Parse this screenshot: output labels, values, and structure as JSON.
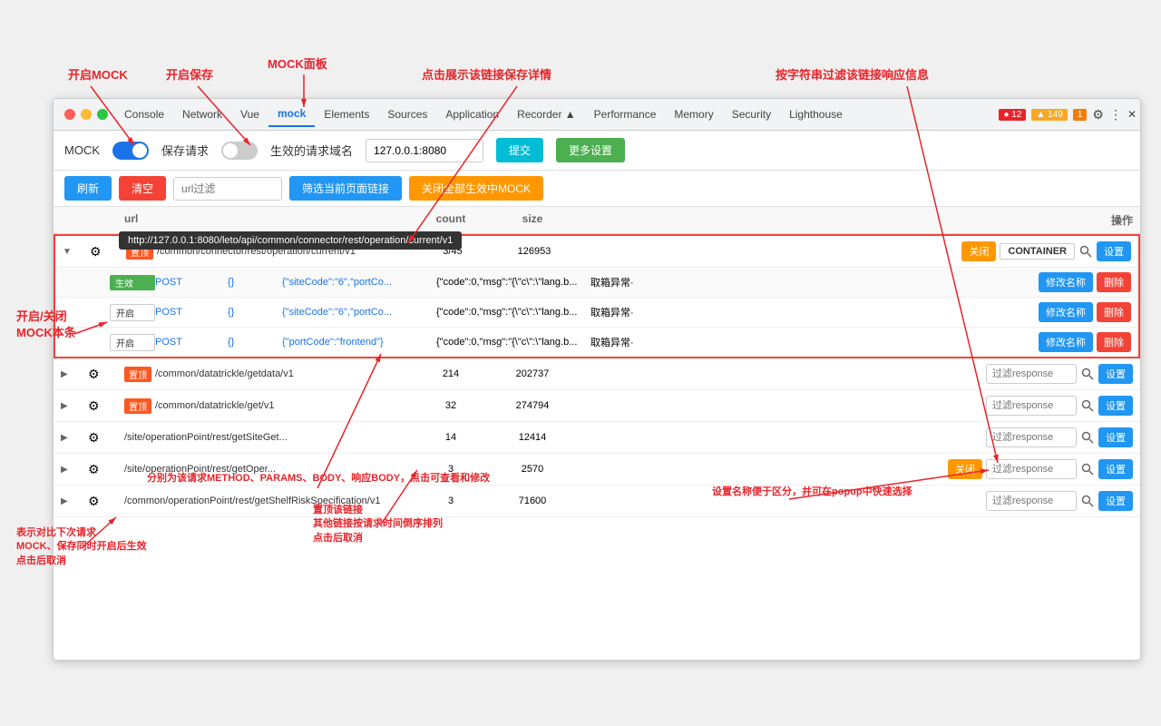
{
  "annotations": {
    "open_mock": "开启MOCK",
    "open_save": "开启保存",
    "mock_panel": "MOCK面板",
    "click_save_detail": "点击展示该链接保存详情",
    "filter_response": "按字符串过滤该链接响应信息",
    "toggle_mock_row": "开启/关闭\nMOCK本条",
    "next_request": "表示对比下次请求\nMOCK、保存同时开启后生效\n点击后取消",
    "set_top": "置顶该链接\n其他链接按请求时间倒序排列\n点击后取消"
  },
  "toolbar": {
    "mock_label": "MOCK",
    "save_label": "保存请求",
    "domain_label": "生效的请求域名",
    "domain_value": "127.0.0.1:8080",
    "submit_label": "提交",
    "more_settings_label": "更多设置"
  },
  "action_bar": {
    "refresh_label": "刷新",
    "clear_label": "清空",
    "url_filter_placeholder": "url过滤",
    "filter_page_label": "筛选当前页面链接",
    "close_all_label": "关闭全部生效中MOCK"
  },
  "table": {
    "headers": [
      "",
      "url",
      "count",
      "size",
      "操作"
    ],
    "url_tooltip": "http://127.0.0.1:8080/leto/api/common/connector/rest/operation/current/v1",
    "rows": [
      {
        "type": "main",
        "expanded": true,
        "tag": "置顶",
        "url": "/common/connector/rest/operation/current/v1",
        "count": "3/45",
        "size": "126953",
        "action_close": "关闭",
        "action_container": "CONTAINER",
        "action_set": "设置",
        "highlighted": true
      },
      {
        "type": "sub",
        "tag": "生效",
        "method": "POST",
        "params": "{}",
        "body": "{\"siteCode\":\"6\",\"portCo...",
        "response": "{\"code\":0,\"msg\":\"{\\\"c\\\":\\\"lang.b...",
        "label": "取箱异常·",
        "action_rename": "修改名称",
        "action_delete": "删除"
      },
      {
        "type": "sub",
        "tag": "开启",
        "method": "POST",
        "params": "{}",
        "body": "{\"siteCode\":\"6\",\"portCo...",
        "response": "{\"code\":0,\"msg\":\"{\\\"c\\\":\\\"lang.b...",
        "label": "取箱异常·",
        "action_rename": "修改名称",
        "action_delete": "删除"
      },
      {
        "type": "sub",
        "tag": "开启",
        "method": "POST",
        "params": "{}",
        "body": "{\"portCode\":\"frontend\"}",
        "response": "{\"code\":0,\"msg\":\"{\\\"c\\\":\\\"lang.b...",
        "label": "取箱异常·",
        "action_rename": "修改名称",
        "action_delete": "删除"
      }
    ],
    "rows2": [
      {
        "type": "main",
        "expanded": false,
        "tag": "置顶",
        "url": "/common/datatrickle/getdata/v1",
        "count": "214",
        "size": "202737",
        "filter_placeholder": "过滤response",
        "action_set": "设置"
      },
      {
        "type": "main",
        "expanded": false,
        "tag": "置顶",
        "url": "/common/datatrickle/get/v1",
        "count": "32",
        "size": "274794",
        "filter_placeholder": "过滤response",
        "action_set": "设置"
      },
      {
        "type": "main",
        "expanded": false,
        "tag": "",
        "url": "/site/operationPoint/rest/getSiteGet...",
        "count": "14",
        "size": "12414",
        "filter_placeholder": "过滤response",
        "action_set": "设置"
      },
      {
        "type": "main",
        "expanded": false,
        "tag": "",
        "url": "/site/operationPoint/rest/getOper...",
        "count": "3",
        "size": "2570",
        "action_close": "关闭",
        "filter_placeholder": "过滤response",
        "action_set": "设置"
      },
      {
        "type": "main",
        "expanded": false,
        "tag": "",
        "url": "/common/operationPoint/rest/getShelfRiskSpecification/v1",
        "count": "3",
        "size": "71600",
        "filter_placeholder": "过滤response",
        "action_set": "设置"
      }
    ]
  },
  "devtools": {
    "tabs": [
      "Console",
      "Network",
      "Vue",
      "mock",
      "Elements",
      "Sources",
      "Application",
      "Recorder ▲",
      "Performance",
      "Memory",
      "Security",
      "Lighthouse"
    ],
    "active_tab": "mock",
    "badge1": "● 12",
    "badge2": "▲ 149",
    "badge3": "1",
    "icon_gear": "⚙",
    "icon_dots": "⋮",
    "icon_close": "✕"
  }
}
